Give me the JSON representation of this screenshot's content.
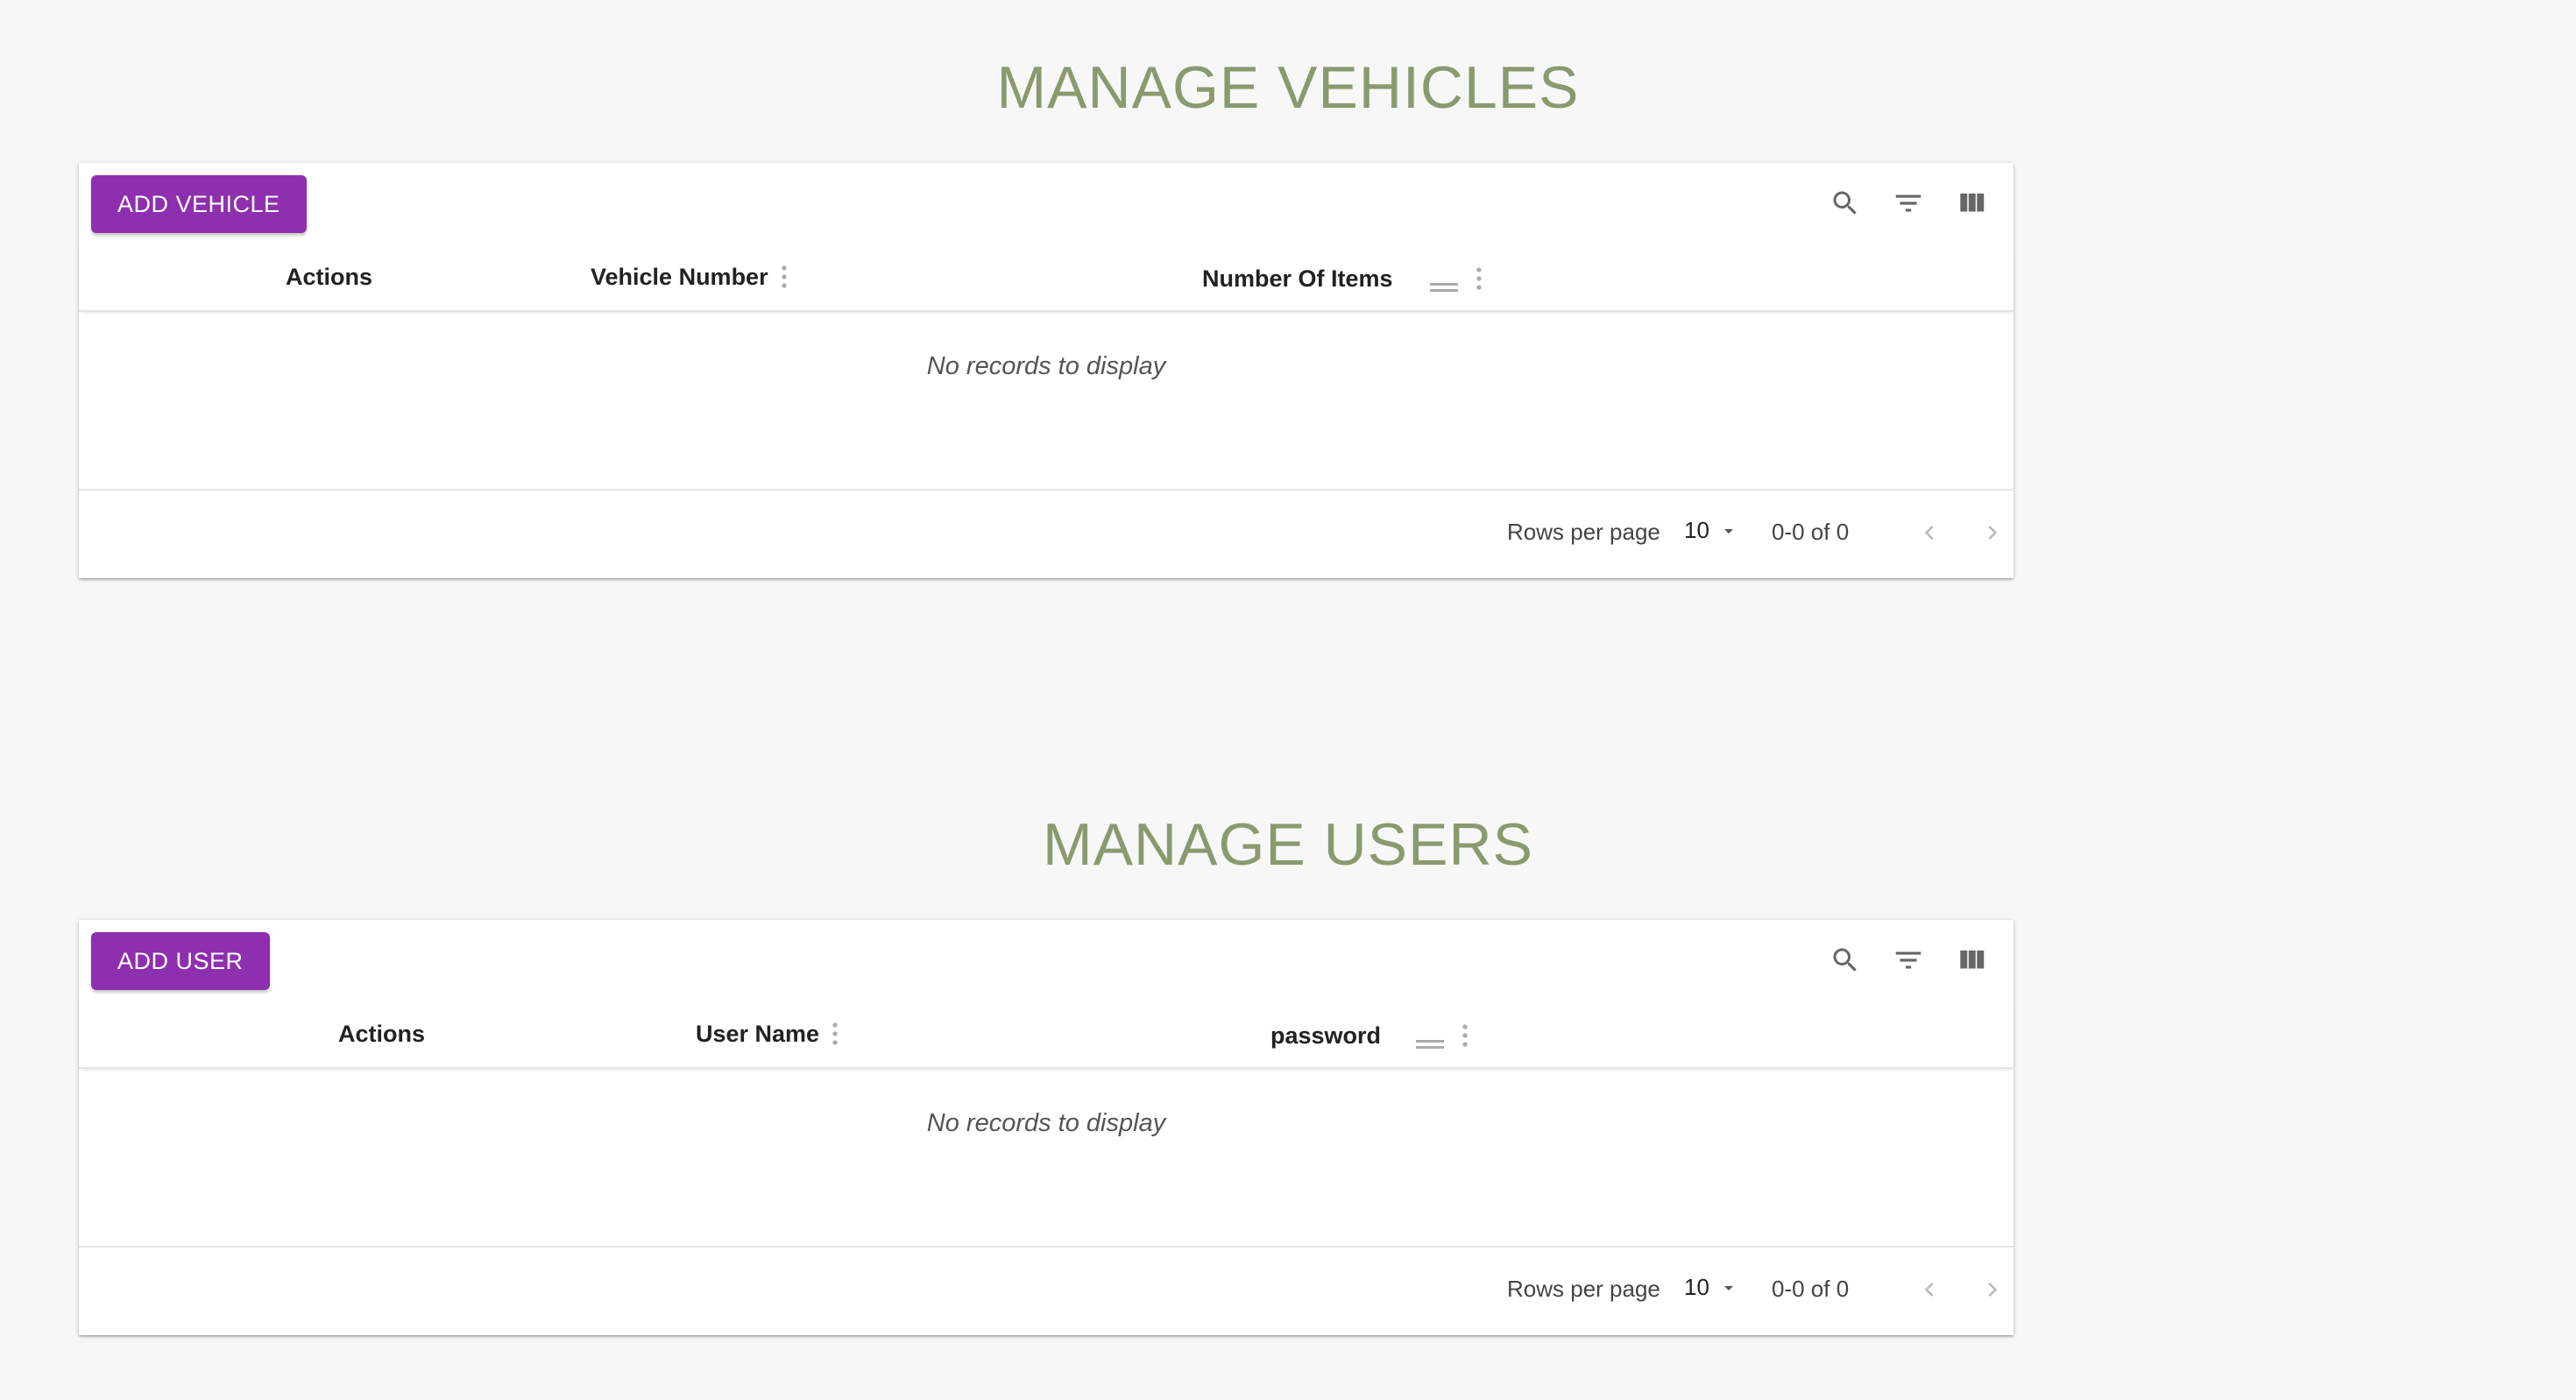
{
  "vehicles": {
    "title": "MANAGE VEHICLES",
    "add_label": "ADD VEHICLE",
    "columns": [
      "Actions",
      "Vehicle Number",
      "Number Of Items"
    ],
    "empty_message": "No records to display",
    "pagination": {
      "rows_per_page_label": "Rows per page",
      "rows_per_page_value": "10",
      "range": "0-0 of 0"
    }
  },
  "users": {
    "title": "MANAGE USERS",
    "add_label": "ADD USER",
    "columns": [
      "Actions",
      "User Name",
      "password"
    ],
    "empty_message": "No records to display",
    "pagination": {
      "rows_per_page_label": "Rows per page",
      "rows_per_page_value": "10",
      "range": "0-0 of 0"
    }
  },
  "icons": [
    "search-icon",
    "filter-icon",
    "view-column-icon",
    "more-vert-icon",
    "drag-handle-icon",
    "arrow-drop-down-icon",
    "chevron-left-icon",
    "chevron-right-icon"
  ],
  "colors": {
    "title": "#8a9a6e",
    "button": "#8e2fb0",
    "background": "#f7f7f7"
  }
}
